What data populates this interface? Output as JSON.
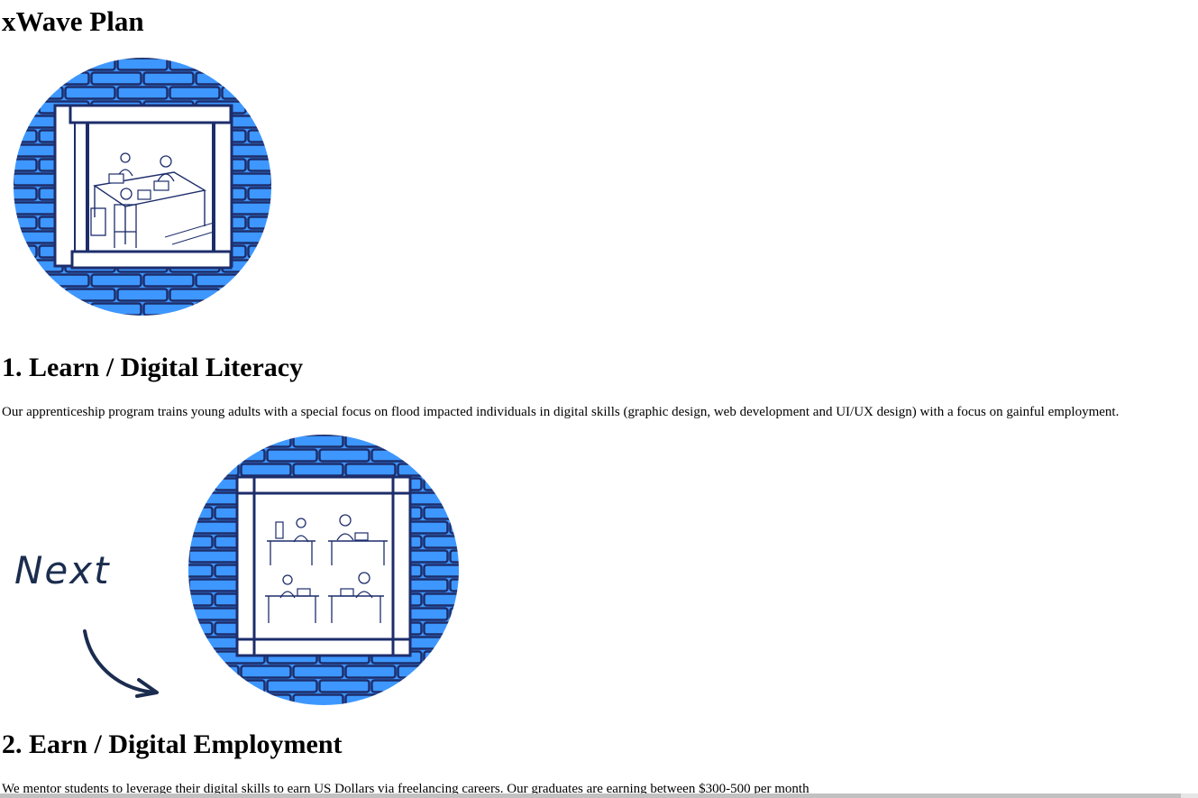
{
  "page": {
    "title": "xWave Plan",
    "sections": [
      {
        "heading": "1. Learn / Digital Literacy",
        "text": "Our apprenticeship program trains young adults with a special focus on flood impacted individuals in digital skills (graphic design, web development and UI/UX design) with a focus on gainful employment."
      },
      {
        "heading": "2. Earn / Digital Employment",
        "text": "We mentor students to leverage their digital skills to earn US Dollars via freelancing careers. Our graduates are earning between $300-500 per month"
      }
    ],
    "next_label": "Next"
  },
  "illustrations": [
    {
      "name": "classroom-window-illustration",
      "icon": "window-classroom"
    },
    {
      "name": "workers-window-illustration",
      "icon": "window-workers"
    }
  ],
  "colors": {
    "brick_blue": "#3d97ff",
    "outline_navy": "#1d2d6b",
    "ink": "#1b2d4f"
  }
}
